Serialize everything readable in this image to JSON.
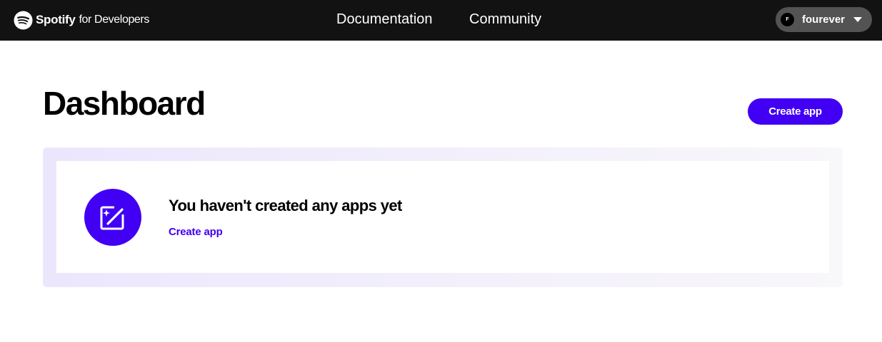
{
  "header": {
    "brand": "Spotify",
    "brand_sub": "for Developers",
    "nav": {
      "documentation": "Documentation",
      "community": "Community"
    },
    "user": {
      "avatar_initial": "F",
      "username": "fourever"
    }
  },
  "main": {
    "title": "Dashboard",
    "create_button": "Create app",
    "empty_state": {
      "title": "You haven't created any apps yet",
      "link": "Create app",
      "icon": "edit-sparkle-icon"
    }
  },
  "colors": {
    "header_bg": "#121212",
    "accent": "#4100f4",
    "pill_bg": "#535353"
  }
}
